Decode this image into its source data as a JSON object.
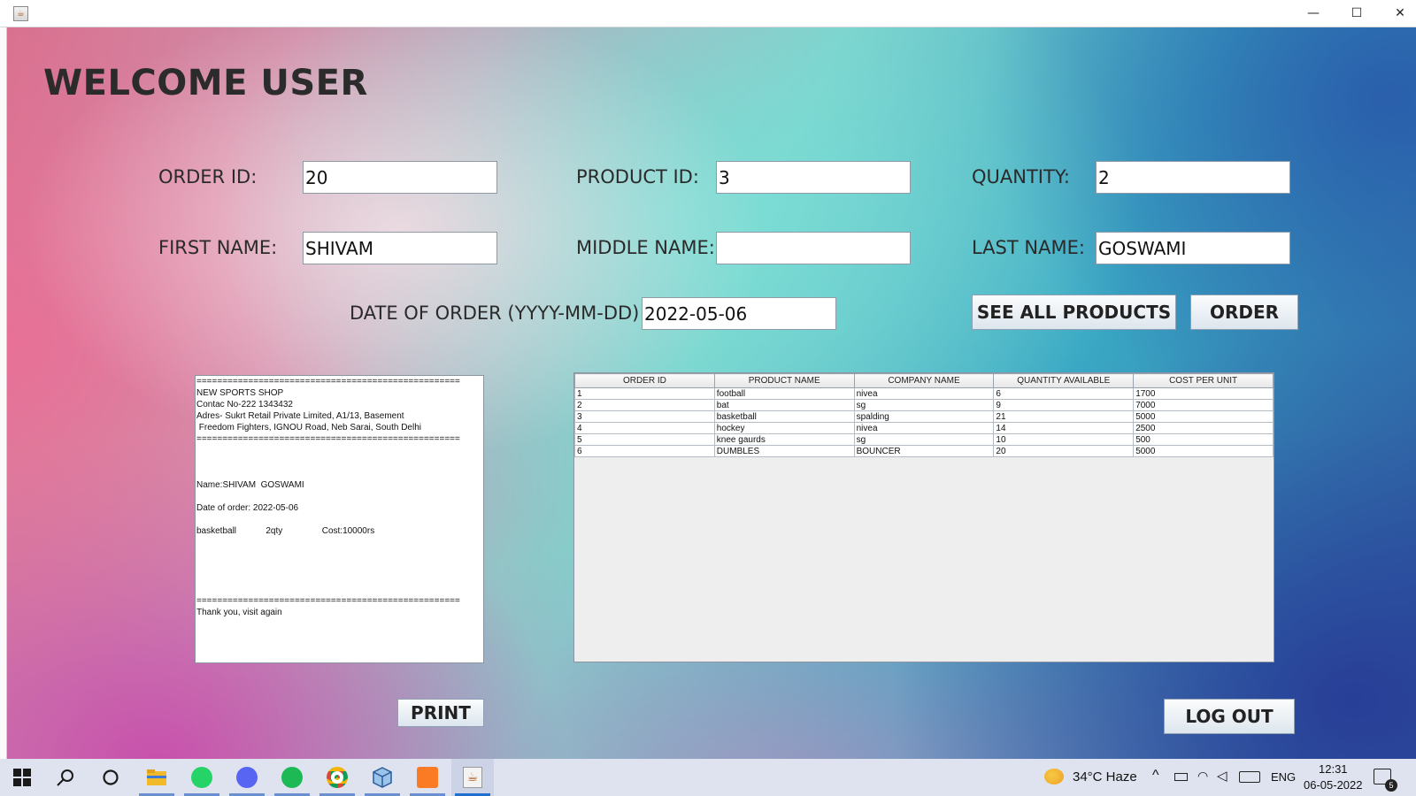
{
  "window": {
    "minimize": "—",
    "maximize": "☐",
    "close": "✕"
  },
  "title": "WELCOME USER",
  "form": {
    "order_id": {
      "label": "ORDER ID:",
      "value": "20"
    },
    "product_id": {
      "label": "PRODUCT ID:",
      "value": "3"
    },
    "quantity": {
      "label": "QUANTITY:",
      "value": "2"
    },
    "first_name": {
      "label": "FIRST NAME:",
      "value": "SHIVAM"
    },
    "middle_name": {
      "label": "MIDDLE NAME:",
      "value": ""
    },
    "last_name": {
      "label": "LAST NAME:",
      "value": "GOSWAMI"
    },
    "date": {
      "label": "DATE OF ORDER (YYYY-MM-DD)  :",
      "value": "2022-05-06"
    }
  },
  "buttons": {
    "see_all": "SEE ALL PRODUCTS",
    "order": "ORDER",
    "print": "PRINT",
    "logout": "LOG OUT"
  },
  "receipt": {
    "separator": "===================================================",
    "shop": "NEW SPORTS SHOP",
    "contact": "Contac No-222 1343432",
    "address1": "Adres- Sukrt Retail Private Limited, A1/13, Basement",
    "address2": " Freedom Fighters, IGNOU Road, Neb Sarai, South Delhi",
    "name": "Name:SHIVAM  GOSWAMI",
    "date": "Date of order: 2022-05-06",
    "item": "basketball            2qty                Cost:10000rs",
    "thanks": "Thank you, visit again"
  },
  "table": {
    "headers": [
      "ORDER ID",
      "PRODUCT NAME",
      "COMPANY NAME",
      "QUANTITY AVAILABLE",
      "COST PER UNIT"
    ],
    "rows": [
      [
        "1",
        "football",
        "nivea",
        "6",
        "1700"
      ],
      [
        "2",
        "bat",
        "sg",
        "9",
        "7000"
      ],
      [
        "3",
        "basketball",
        "spalding",
        "21",
        "5000"
      ],
      [
        "4",
        "hockey",
        "nivea",
        "14",
        "2500"
      ],
      [
        "5",
        "knee gaurds",
        "sg",
        "10",
        "500"
      ],
      [
        "6",
        "DUMBLES",
        "BOUNCER",
        "20",
        "5000"
      ]
    ]
  },
  "taskbar": {
    "weather": "34°C  Haze",
    "language": "ENG",
    "time": "12:31",
    "date": "06-05-2022",
    "notification_count": "5"
  }
}
